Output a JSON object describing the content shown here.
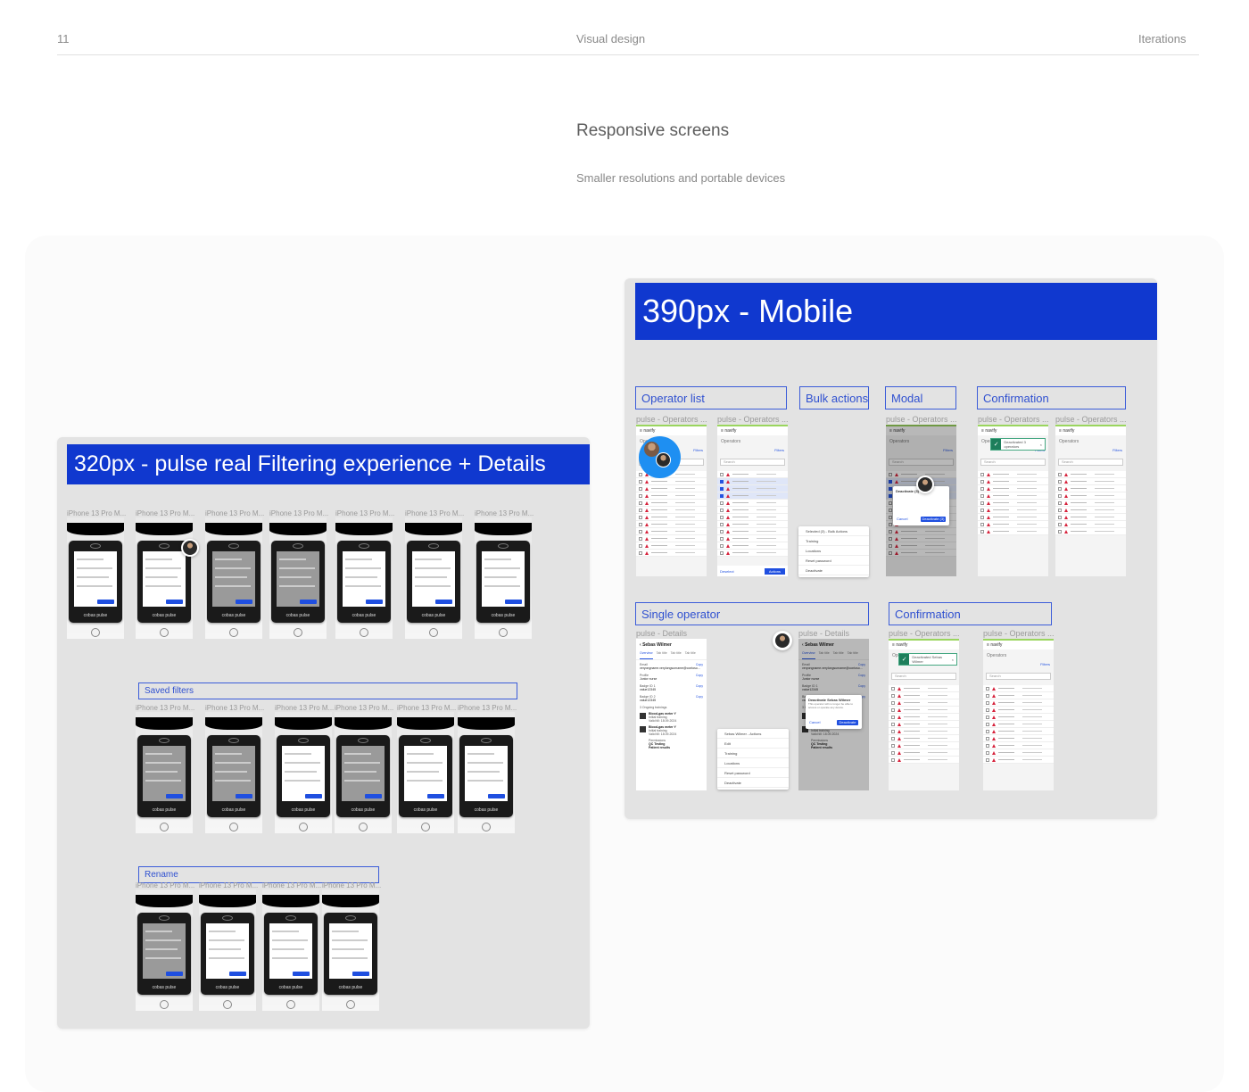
{
  "header": {
    "page_number": "11",
    "section": "Visual design",
    "chapter": "Iterations"
  },
  "intro": {
    "title": "Responsive screens",
    "subtitle": "Smaller resolutions and portable devices"
  },
  "board_320": {
    "banner": "320px - pulse real Filtering experience + Details",
    "frame_title": "iPhone 13 Pro M...",
    "device_brand": "cobas pulse",
    "groups": [
      {
        "label": "",
        "count": 7
      },
      {
        "label": "Saved filters",
        "count": 6
      },
      {
        "label": "Rename",
        "count": 4
      }
    ]
  },
  "board_390": {
    "banner": "390px - Mobile",
    "brand": "navify",
    "sections": [
      {
        "label": "Operator list",
        "frames": [
          "pulse - Operators ...",
          "pulse - Operators ..."
        ]
      },
      {
        "label": "Bulk actions",
        "frames": []
      },
      {
        "label": "Modal",
        "frames": [
          "pulse - Operators ..."
        ]
      },
      {
        "label": "Confirmation",
        "frames": [
          "pulse - Operators ...",
          "pulse - Operators ..."
        ]
      },
      {
        "label": "Single operator",
        "frames": [
          "pulse - Details",
          "pulse - Details"
        ]
      },
      {
        "label": "Confirmation",
        "frames": [
          "pulse - Operators ...",
          "pulse - Operators ..."
        ]
      }
    ],
    "operators_heading": "Operators",
    "filters_label": "Filters",
    "search_placeholder": "Search",
    "bulk_menu": [
      "Selected (3) - Bulk Actions",
      "Training",
      "Locations",
      "Reset password",
      "Deactivate"
    ],
    "bulk_footer": {
      "deselect": "Deselect",
      "actions": "Actions"
    },
    "modal": {
      "title": "Deactivate (3)",
      "cancel": "Cancel",
      "confirm": "Deactivate (3)"
    },
    "toast_1": "Deactivated 3 operators",
    "toast_2": "Deactivated Sebas Wilmer",
    "details": {
      "name": "Sebas Wilmer",
      "tabs": [
        "Overview",
        "Tab title",
        "Tab title",
        "Tab title"
      ],
      "fields": [
        {
          "label": "Email",
          "value": "veryongname.verylongsurname@contoso...",
          "action": "Copy"
        },
        {
          "label": "Profile",
          "value": "Junior nurse",
          "action": "Copy"
        },
        {
          "label": "Badge ID 1",
          "value": "value12345",
          "action": "Copy"
        },
        {
          "label": "Badge ID 2",
          "value": "value12345",
          "action": "Copy"
        }
      ],
      "trainings_label": "3 Ongoing trainings",
      "trainings": [
        {
          "title": "Blood-gas meter Y",
          "status": "Initial training",
          "valid": "Valid till: 18.09.2024"
        },
        {
          "title": "Blood-gas meter Y",
          "status": "Initial training",
          "valid": "Valid till: 18.09.2024"
        }
      ],
      "permissions_label": "Permissions",
      "permissions": [
        "QC Testing",
        "Patient results"
      ],
      "actions_menu": [
        "Sebas Wilmer - Actions",
        "Edit",
        "Training",
        "Locations",
        "Reset password",
        "Deactivate"
      ],
      "modal": {
        "title": "Deactivate Sebas Wilmer",
        "body": "This operator will no longer be able to access or operate any device.",
        "cancel": "Cancel",
        "confirm": "Deactivate"
      }
    }
  },
  "colors": {
    "banner": "#1038cf",
    "label_border": "#3b5cd9",
    "accent_green": "#9ad55e",
    "toast_green": "#1d7e5b",
    "alert_red": "#d6223b"
  }
}
